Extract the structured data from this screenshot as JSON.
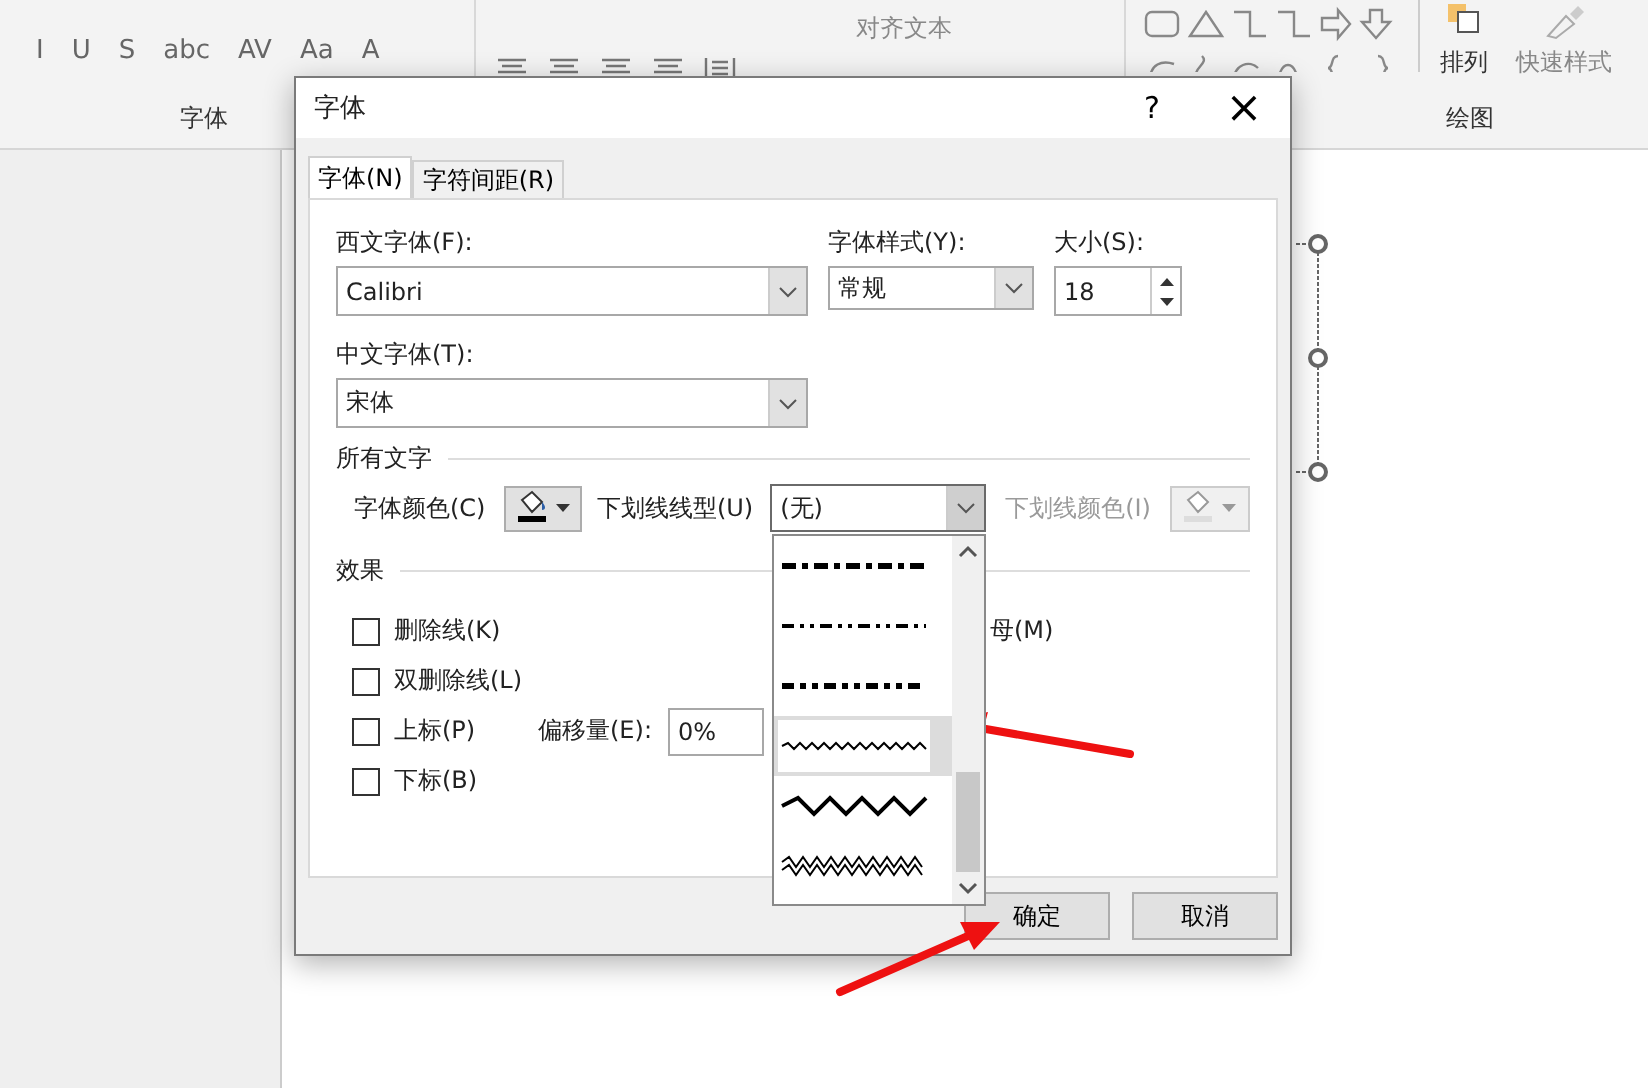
{
  "ribbon": {
    "format_buttons": [
      "I",
      "U",
      "S",
      "abc",
      "AV",
      "Aa",
      "A"
    ],
    "align_text": "对齐文本",
    "font_group": "字体",
    "arrange": "排列",
    "quick_styles": "快速样式",
    "drawing_group": "绘图"
  },
  "dialog": {
    "title": "字体",
    "help": "?",
    "close": "×",
    "tabs": [
      {
        "label": "字体(N)",
        "selected": true
      },
      {
        "label": "字符间距(R)",
        "selected": false
      }
    ],
    "latin_font": {
      "label": "西文字体(F):",
      "value": "Calibri"
    },
    "font_style": {
      "label": "字体样式(Y):",
      "value": "常规"
    },
    "size": {
      "label": "大小(S):",
      "value": "18"
    },
    "asian_font": {
      "label": "中文字体(T):",
      "value": "宋体"
    },
    "all_text": {
      "heading": "所有文字",
      "font_color": {
        "label": "字体颜色(C)"
      },
      "underline_style": {
        "label": "下划线线型(U)",
        "value": "(无)",
        "expanded": true,
        "options": [
          {
            "kind": "dash-dot-heavy",
            "selected": false
          },
          {
            "kind": "dash-dot-dot",
            "selected": false
          },
          {
            "kind": "dash-dot-dot-heavy",
            "selected": false
          },
          {
            "kind": "wavy",
            "selected": true
          },
          {
            "kind": "wavy-heavy",
            "selected": false
          },
          {
            "kind": "wavy-double",
            "selected": false
          }
        ]
      },
      "underline_color": {
        "label": "下划线颜色(I)",
        "disabled": true
      }
    },
    "effects": {
      "heading": "效果",
      "checkboxes": [
        {
          "label": "删除线(K)",
          "checked": false
        },
        {
          "label": "双删除线(L)",
          "checked": false
        },
        {
          "label": "上标(P)",
          "checked": false
        },
        {
          "label": "下标(B)",
          "checked": false
        }
      ],
      "small_caps_label": "母(M)",
      "offset": {
        "label": "偏移量(E):",
        "value": "0%"
      }
    },
    "buttons": [
      "确定",
      "取消"
    ]
  }
}
